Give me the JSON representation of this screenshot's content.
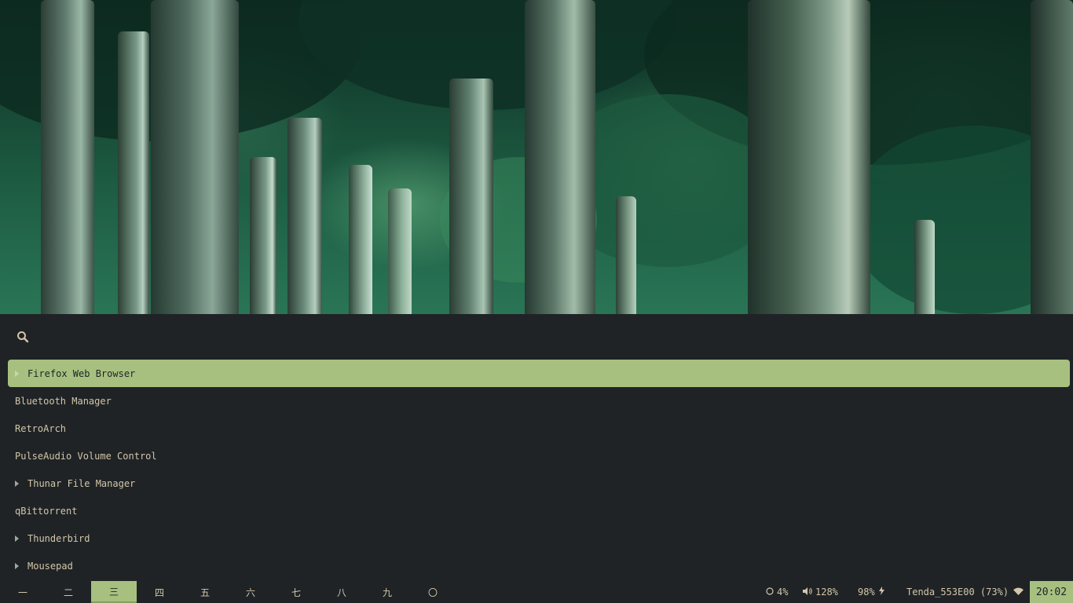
{
  "wallpaper": {
    "description_icon": "forest-wallpaper"
  },
  "launcher": {
    "search": {
      "value": "",
      "placeholder": ""
    },
    "items": [
      {
        "label": "Firefox Web Browser",
        "has_children": true,
        "selected": true
      },
      {
        "label": "Bluetooth Manager",
        "has_children": false,
        "selected": false
      },
      {
        "label": "RetroArch",
        "has_children": false,
        "selected": false
      },
      {
        "label": "PulseAudio Volume Control",
        "has_children": false,
        "selected": false
      },
      {
        "label": "Thunar File Manager",
        "has_children": true,
        "selected": false
      },
      {
        "label": "qBittorrent",
        "has_children": false,
        "selected": false
      },
      {
        "label": "Thunderbird",
        "has_children": true,
        "selected": false
      },
      {
        "label": "Mousepad",
        "has_children": true,
        "selected": false
      }
    ]
  },
  "bar": {
    "workspaces": [
      "一",
      "二",
      "三",
      "四",
      "五",
      "六",
      "七",
      "八",
      "九",
      "〇"
    ],
    "active_workspace": 2,
    "cpu": "4%",
    "volume": "128%",
    "battery": "98%",
    "network": "Tenda_553E00 (73%)",
    "clock": "20:02"
  },
  "colors": {
    "accent": "#a7c080",
    "background": "#1f2326",
    "text": "#d3c6aa"
  }
}
